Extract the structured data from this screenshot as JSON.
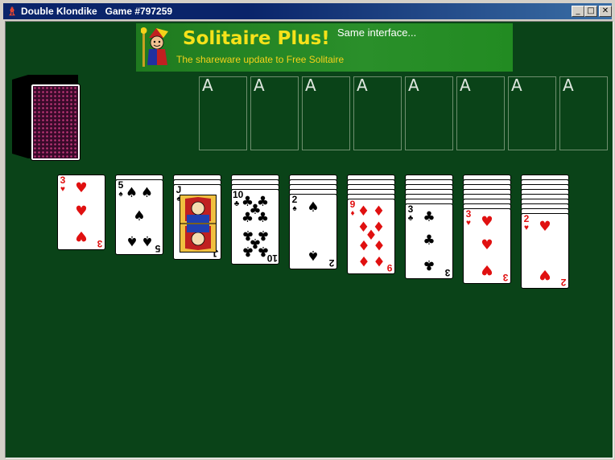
{
  "window": {
    "title": "Double Klondike   Game #797259",
    "icon": "jester-icon",
    "controls": {
      "minimize": "_",
      "maximize": "□",
      "close": "✕"
    }
  },
  "ad": {
    "title": "Solitaire Plus!",
    "subtitle": "The shareware update to Free Solitaire",
    "tagline": "Same interface..."
  },
  "colors": {
    "felt": "#0a4318",
    "banner": "#228b22",
    "banner_text": "#f5e21a",
    "red_suit": "#e01010",
    "black_suit": "#000000",
    "card_back": "#3a0a2a"
  },
  "stock": {
    "face_down": true
  },
  "foundations": [
    {
      "label": "A"
    },
    {
      "label": "A"
    },
    {
      "label": "A"
    },
    {
      "label": "A"
    },
    {
      "label": "A"
    },
    {
      "label": "A"
    },
    {
      "label": "A"
    },
    {
      "label": "A"
    }
  ],
  "tableau": [
    {
      "hidden": 0,
      "rank": "3",
      "suit": "♥",
      "color": "red"
    },
    {
      "hidden": 1,
      "rank": "5",
      "suit": "♠",
      "color": "black"
    },
    {
      "hidden": 2,
      "rank": "J",
      "suit": "♠",
      "color": "black"
    },
    {
      "hidden": 3,
      "rank": "10",
      "suit": "♣",
      "color": "black"
    },
    {
      "hidden": 4,
      "rank": "2",
      "suit": "♠",
      "color": "black"
    },
    {
      "hidden": 5,
      "rank": "9",
      "suit": "♦",
      "color": "red"
    },
    {
      "hidden": 6,
      "rank": "3",
      "suit": "♣",
      "color": "black"
    },
    {
      "hidden": 7,
      "rank": "3",
      "suit": "♥",
      "color": "red"
    },
    {
      "hidden": 8,
      "rank": "2",
      "suit": "♥",
      "color": "red"
    }
  ]
}
